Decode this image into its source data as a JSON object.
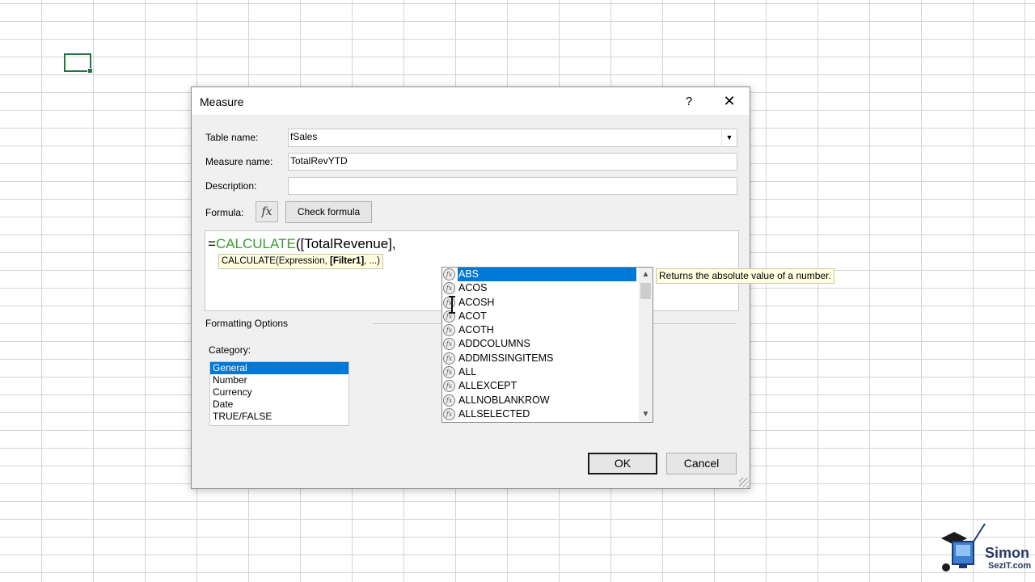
{
  "dialog": {
    "title": "Measure",
    "help_label": "?",
    "close_label": "✕",
    "table_name_label": "Table name:",
    "table_name_value": "fSales",
    "measure_name_label": "Measure name:",
    "measure_name_value": "TotalRevYTD",
    "description_label": "Description:",
    "description_value": "",
    "formula_label": "Formula:",
    "fx_label": "fx",
    "check_formula_label": "Check formula",
    "formula_prefix": "=",
    "formula_keyword": "CALCULATE",
    "formula_rest": "([TotalRevenue],",
    "signature_prefix": "CALCULATE(Expression, ",
    "signature_bold": "[Filter1]",
    "signature_suffix": ", ...)",
    "formatting_options_label": "Formatting Options",
    "category_label": "Category:",
    "categories": [
      "General",
      "Number",
      "Currency",
      "Date",
      "TRUE/FALSE"
    ],
    "selected_category": "General",
    "ok_label": "OK",
    "cancel_label": "Cancel"
  },
  "autocomplete": {
    "items": [
      "ABS",
      "ACOS",
      "ACOSH",
      "ACOT",
      "ACOTH",
      "ADDCOLUMNS",
      "ADDMISSINGITEMS",
      "ALL",
      "ALLEXCEPT",
      "ALLNOBLANKROW",
      "ALLSELECTED"
    ],
    "selected": "ABS",
    "tooltip": "Returns the absolute value of a number."
  },
  "logo": {
    "name": "Simon",
    "sub": "SezIT.com"
  },
  "colors": {
    "selection": "#0078d7",
    "formula_keyword": "#3a9a2e",
    "cell_selection": "#217346"
  }
}
